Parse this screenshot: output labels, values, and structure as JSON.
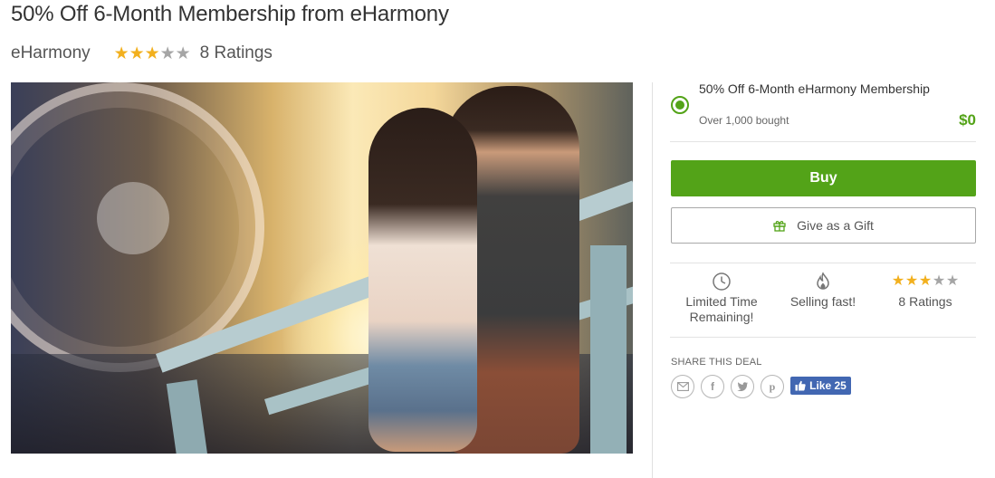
{
  "deal": {
    "title": "50% Off 6-Month Membership from eHarmony",
    "merchant": "eHarmony",
    "rating_stars": 3,
    "rating_max": 5,
    "ratings_label": "8 Ratings"
  },
  "option": {
    "title": "50% Off 6-Month eHarmony Membership",
    "bought": "Over 1,000 bought",
    "price": "$0",
    "selected": true
  },
  "actions": {
    "buy_label": "Buy",
    "gift_label": "Give as a Gift"
  },
  "features": {
    "limited_time": "Limited Time Remaining!",
    "selling_fast": "Selling fast!",
    "ratings": "8 Ratings"
  },
  "share": {
    "label": "SHARE THIS DEAL",
    "icons": [
      "email-icon",
      "facebook-icon",
      "twitter-icon",
      "pinterest-icon"
    ],
    "fb_like_label": "Like 25"
  },
  "colors": {
    "accent_green": "#53a318",
    "star_gold": "#f2b01e",
    "star_gray": "#a5a5a5",
    "facebook_blue": "#4267b2"
  }
}
